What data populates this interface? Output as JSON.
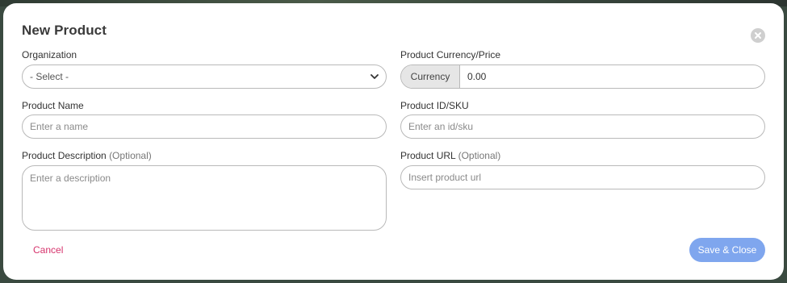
{
  "dialog": {
    "title": "New Product",
    "close_icon": "close-icon"
  },
  "fields": {
    "organization": {
      "label": "Organization",
      "selected": "- Select -"
    },
    "currency_price": {
      "label": "Product Currency/Price",
      "currency_addon": "Currency",
      "price_value": "0.00"
    },
    "product_name": {
      "label": "Product Name",
      "placeholder": "Enter a name"
    },
    "product_id": {
      "label": "Product ID/SKU",
      "placeholder": "Enter an id/sku"
    },
    "product_description": {
      "label": "Product Description",
      "optional": "(Optional)",
      "placeholder": "Enter a description"
    },
    "product_url": {
      "label": "Product URL",
      "optional": "(Optional)",
      "placeholder": "Insert product url"
    }
  },
  "footer": {
    "cancel_label": "Cancel",
    "save_label": "Save & Close"
  },
  "colors": {
    "accent": "#7fa6ee",
    "cancel": "#d6336c"
  }
}
